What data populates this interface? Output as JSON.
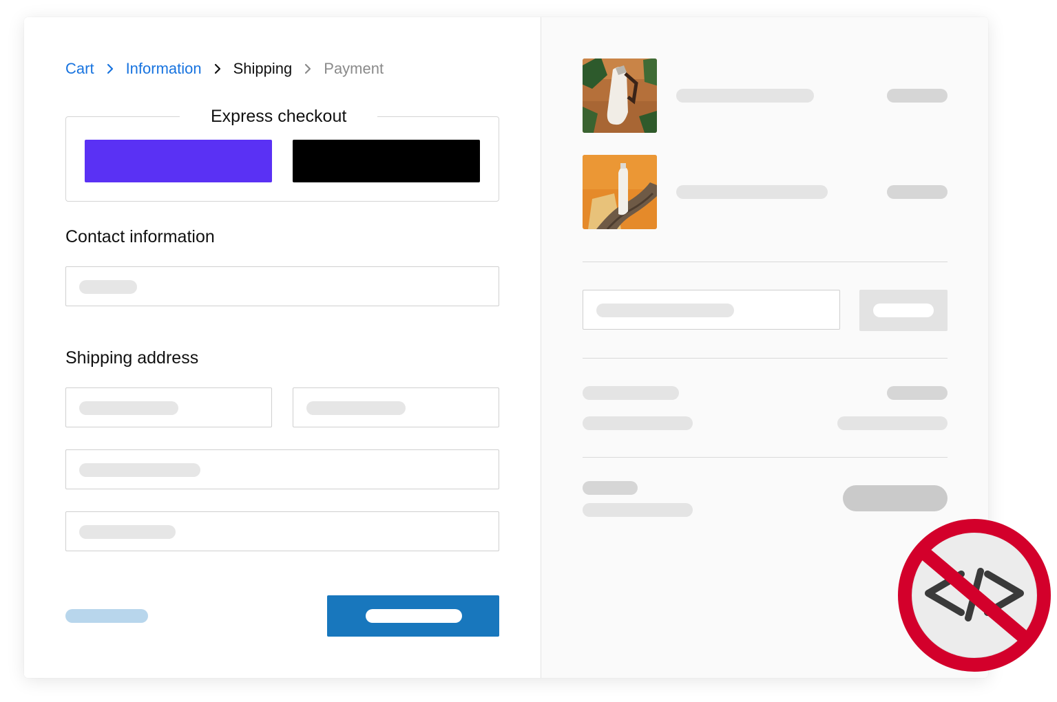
{
  "breadcrumb": {
    "items": [
      {
        "label": "Cart"
      },
      {
        "label": "Information"
      },
      {
        "label": "Shipping"
      },
      {
        "label": "Payment"
      }
    ]
  },
  "express_checkout": {
    "title": "Express checkout",
    "buttons": [
      {
        "color": "#5a31f4"
      },
      {
        "color": "#000000"
      }
    ]
  },
  "contact": {
    "title": "Contact information"
  },
  "shipping": {
    "title": "Shipping address"
  },
  "colors": {
    "link": "#1773df",
    "primary_button": "#1877bd",
    "secondary_link_placeholder": "#b8d6ec",
    "skeleton": "#e4e4e4",
    "no_code_badge": "#d3002b"
  },
  "icons": {
    "breadcrumb_separator": "chevron-right-icon",
    "badge": "no-code-icon"
  }
}
